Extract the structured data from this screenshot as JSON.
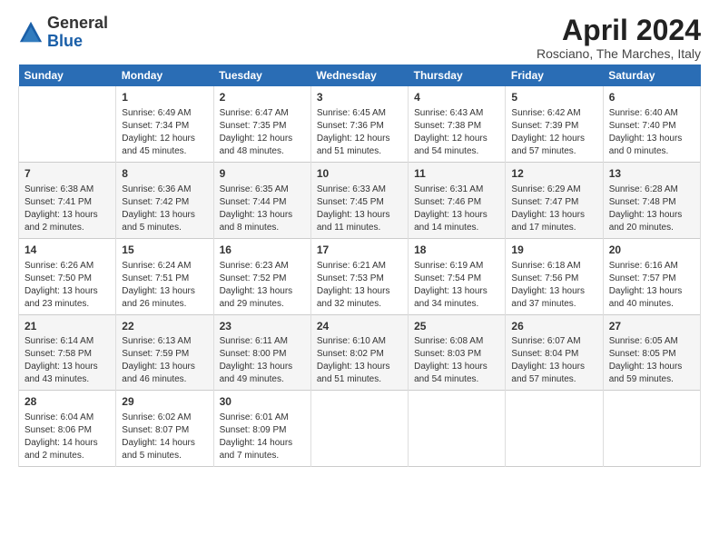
{
  "header": {
    "logo_general": "General",
    "logo_blue": "Blue",
    "title": "April 2024",
    "location": "Rosciano, The Marches, Italy"
  },
  "calendar": {
    "columns": [
      "Sunday",
      "Monday",
      "Tuesday",
      "Wednesday",
      "Thursday",
      "Friday",
      "Saturday"
    ],
    "weeks": [
      [
        {
          "day": "",
          "content": ""
        },
        {
          "day": "1",
          "content": "Sunrise: 6:49 AM\nSunset: 7:34 PM\nDaylight: 12 hours\nand 45 minutes."
        },
        {
          "day": "2",
          "content": "Sunrise: 6:47 AM\nSunset: 7:35 PM\nDaylight: 12 hours\nand 48 minutes."
        },
        {
          "day": "3",
          "content": "Sunrise: 6:45 AM\nSunset: 7:36 PM\nDaylight: 12 hours\nand 51 minutes."
        },
        {
          "day": "4",
          "content": "Sunrise: 6:43 AM\nSunset: 7:38 PM\nDaylight: 12 hours\nand 54 minutes."
        },
        {
          "day": "5",
          "content": "Sunrise: 6:42 AM\nSunset: 7:39 PM\nDaylight: 12 hours\nand 57 minutes."
        },
        {
          "day": "6",
          "content": "Sunrise: 6:40 AM\nSunset: 7:40 PM\nDaylight: 13 hours\nand 0 minutes."
        }
      ],
      [
        {
          "day": "7",
          "content": "Sunrise: 6:38 AM\nSunset: 7:41 PM\nDaylight: 13 hours\nand 2 minutes."
        },
        {
          "day": "8",
          "content": "Sunrise: 6:36 AM\nSunset: 7:42 PM\nDaylight: 13 hours\nand 5 minutes."
        },
        {
          "day": "9",
          "content": "Sunrise: 6:35 AM\nSunset: 7:44 PM\nDaylight: 13 hours\nand 8 minutes."
        },
        {
          "day": "10",
          "content": "Sunrise: 6:33 AM\nSunset: 7:45 PM\nDaylight: 13 hours\nand 11 minutes."
        },
        {
          "day": "11",
          "content": "Sunrise: 6:31 AM\nSunset: 7:46 PM\nDaylight: 13 hours\nand 14 minutes."
        },
        {
          "day": "12",
          "content": "Sunrise: 6:29 AM\nSunset: 7:47 PM\nDaylight: 13 hours\nand 17 minutes."
        },
        {
          "day": "13",
          "content": "Sunrise: 6:28 AM\nSunset: 7:48 PM\nDaylight: 13 hours\nand 20 minutes."
        }
      ],
      [
        {
          "day": "14",
          "content": "Sunrise: 6:26 AM\nSunset: 7:50 PM\nDaylight: 13 hours\nand 23 minutes."
        },
        {
          "day": "15",
          "content": "Sunrise: 6:24 AM\nSunset: 7:51 PM\nDaylight: 13 hours\nand 26 minutes."
        },
        {
          "day": "16",
          "content": "Sunrise: 6:23 AM\nSunset: 7:52 PM\nDaylight: 13 hours\nand 29 minutes."
        },
        {
          "day": "17",
          "content": "Sunrise: 6:21 AM\nSunset: 7:53 PM\nDaylight: 13 hours\nand 32 minutes."
        },
        {
          "day": "18",
          "content": "Sunrise: 6:19 AM\nSunset: 7:54 PM\nDaylight: 13 hours\nand 34 minutes."
        },
        {
          "day": "19",
          "content": "Sunrise: 6:18 AM\nSunset: 7:56 PM\nDaylight: 13 hours\nand 37 minutes."
        },
        {
          "day": "20",
          "content": "Sunrise: 6:16 AM\nSunset: 7:57 PM\nDaylight: 13 hours\nand 40 minutes."
        }
      ],
      [
        {
          "day": "21",
          "content": "Sunrise: 6:14 AM\nSunset: 7:58 PM\nDaylight: 13 hours\nand 43 minutes."
        },
        {
          "day": "22",
          "content": "Sunrise: 6:13 AM\nSunset: 7:59 PM\nDaylight: 13 hours\nand 46 minutes."
        },
        {
          "day": "23",
          "content": "Sunrise: 6:11 AM\nSunset: 8:00 PM\nDaylight: 13 hours\nand 49 minutes."
        },
        {
          "day": "24",
          "content": "Sunrise: 6:10 AM\nSunset: 8:02 PM\nDaylight: 13 hours\nand 51 minutes."
        },
        {
          "day": "25",
          "content": "Sunrise: 6:08 AM\nSunset: 8:03 PM\nDaylight: 13 hours\nand 54 minutes."
        },
        {
          "day": "26",
          "content": "Sunrise: 6:07 AM\nSunset: 8:04 PM\nDaylight: 13 hours\nand 57 minutes."
        },
        {
          "day": "27",
          "content": "Sunrise: 6:05 AM\nSunset: 8:05 PM\nDaylight: 13 hours\nand 59 minutes."
        }
      ],
      [
        {
          "day": "28",
          "content": "Sunrise: 6:04 AM\nSunset: 8:06 PM\nDaylight: 14 hours\nand 2 minutes."
        },
        {
          "day": "29",
          "content": "Sunrise: 6:02 AM\nSunset: 8:07 PM\nDaylight: 14 hours\nand 5 minutes."
        },
        {
          "day": "30",
          "content": "Sunrise: 6:01 AM\nSunset: 8:09 PM\nDaylight: 14 hours\nand 7 minutes."
        },
        {
          "day": "",
          "content": ""
        },
        {
          "day": "",
          "content": ""
        },
        {
          "day": "",
          "content": ""
        },
        {
          "day": "",
          "content": ""
        }
      ]
    ]
  }
}
